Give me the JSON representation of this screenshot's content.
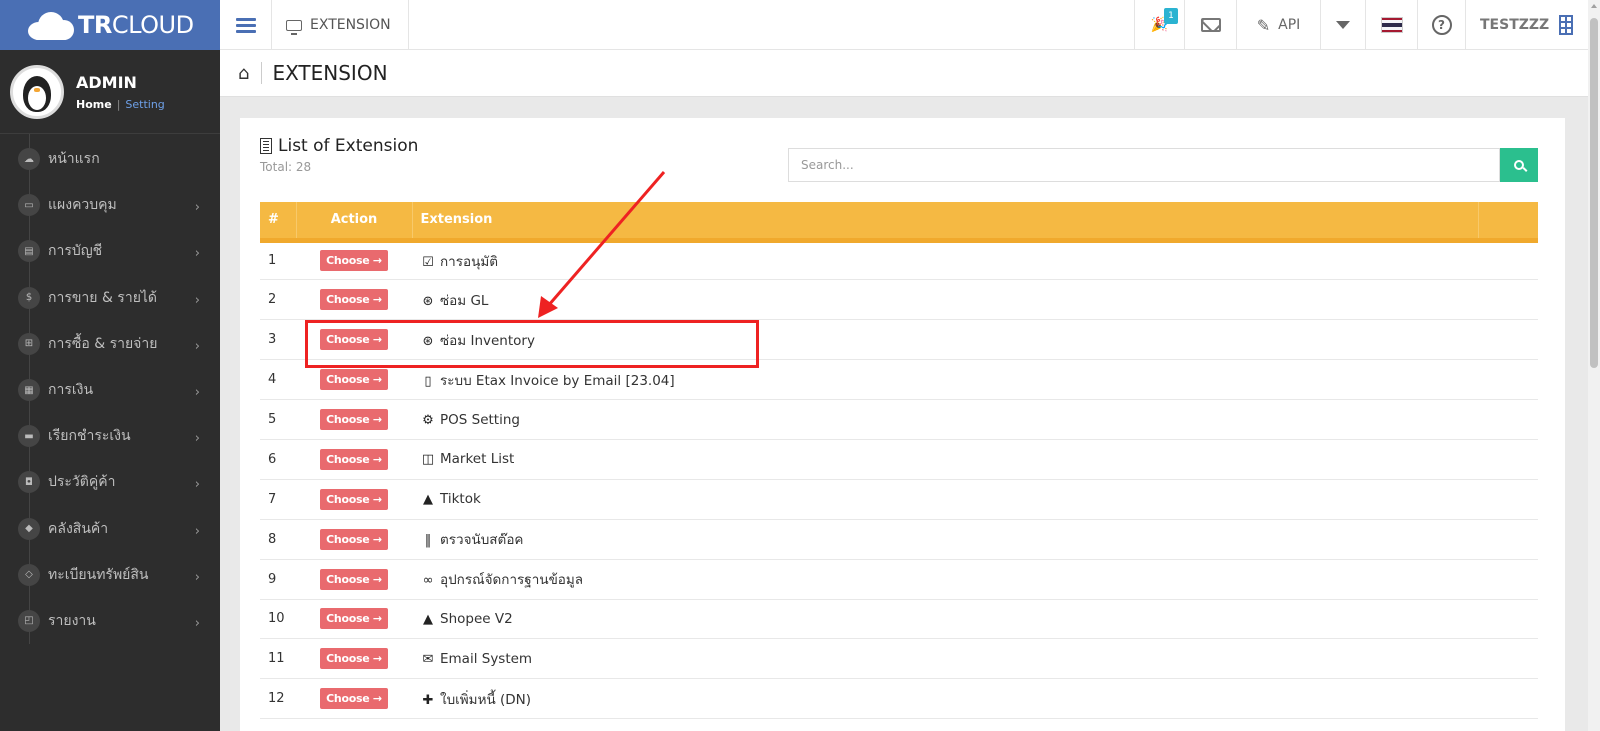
{
  "brand": {
    "bold": "TR",
    "rest": "CLOUD"
  },
  "profile": {
    "name": "ADMIN",
    "home_link": "Home",
    "separator": "|",
    "setting_link": "Setting"
  },
  "sidebar": {
    "items": [
      {
        "label": "หน้าแรก",
        "icon": "cloud-icon",
        "glyph": "☁",
        "has_submenu": false
      },
      {
        "label": "แผงควบคุม",
        "icon": "monitor-icon",
        "glyph": "▭",
        "has_submenu": true
      },
      {
        "label": "การบัญชี",
        "icon": "book-icon",
        "glyph": "▤",
        "has_submenu": true
      },
      {
        "label": "การขาย & รายได้",
        "icon": "dollar-icon",
        "glyph": "$",
        "has_submenu": true
      },
      {
        "label": "การซื้อ & รายจ่าย",
        "icon": "cart-icon",
        "glyph": "⊞",
        "has_submenu": true
      },
      {
        "label": "การเงิน",
        "icon": "calendar-icon",
        "glyph": "▦",
        "has_submenu": true
      },
      {
        "label": "เรียกชำระเงิน",
        "icon": "credit-card-icon",
        "glyph": "▬",
        "has_submenu": true
      },
      {
        "label": "ประวัติคู่ค้า",
        "icon": "contact-icon",
        "glyph": "◘",
        "has_submenu": true
      },
      {
        "label": "คลังสินค้า",
        "icon": "cubes-icon",
        "glyph": "◆",
        "has_submenu": true
      },
      {
        "label": "ทะเบียนทรัพย์สิน",
        "icon": "diamond-icon",
        "glyph": "◇",
        "has_submenu": true
      },
      {
        "label": "รายงาน",
        "icon": "report-icon",
        "glyph": "◰",
        "has_submenu": true
      }
    ]
  },
  "topbar": {
    "section_title": "EXTENSION",
    "notification_count": "1",
    "api_label": "API",
    "company_name": "TESTZZZ",
    "flag_colors": [
      "#a51931",
      "#f4f5f8",
      "#2d2a4a",
      "#2d2a4a",
      "#f4f5f8",
      "#a51931"
    ]
  },
  "page": {
    "title": "EXTENSION",
    "panel_title": "List of Extension",
    "total_label": "Total: 28",
    "search_placeholder": "Search..."
  },
  "table": {
    "headers": {
      "num": "#",
      "action": "Action",
      "extension": "Extension"
    },
    "choose_label": "Choose →",
    "rows": [
      {
        "num": "1",
        "name": "การอนุมัติ",
        "icon": "check-square-icon",
        "glyph": "☑"
      },
      {
        "num": "2",
        "name": "ซ่อม GL",
        "icon": "life-ring-icon",
        "glyph": "⊛"
      },
      {
        "num": "3",
        "name": "ซ่อม Inventory",
        "icon": "life-ring-icon",
        "glyph": "⊛"
      },
      {
        "num": "4",
        "name": "ระบบ Etax Invoice by Email [23.04]",
        "icon": "file-icon",
        "glyph": "▯"
      },
      {
        "num": "5",
        "name": "POS Setting",
        "icon": "cogs-icon",
        "glyph": "⚙"
      },
      {
        "num": "6",
        "name": "Market List",
        "icon": "columns-icon",
        "glyph": "◫"
      },
      {
        "num": "7",
        "name": "Tiktok",
        "icon": "shopping-bag-icon",
        "glyph": "▲"
      },
      {
        "num": "8",
        "name": "ตรวจนับสต๊อค",
        "icon": "barcode-icon",
        "glyph": "‖"
      },
      {
        "num": "9",
        "name": "อุปกรณ์จัดการฐานข้อมูล",
        "icon": "link-icon",
        "glyph": "∞"
      },
      {
        "num": "10",
        "name": "Shopee V2",
        "icon": "shopping-bag-icon",
        "glyph": "▲"
      },
      {
        "num": "11",
        "name": "Email System",
        "icon": "envelope-icon",
        "glyph": "✉"
      },
      {
        "num": "12",
        "name": "ใบเพิ่มหนี้ (DN)",
        "icon": "plus-icon",
        "glyph": "✚"
      }
    ]
  },
  "annotation": {
    "color": "#ee2222",
    "target_row": "3"
  }
}
